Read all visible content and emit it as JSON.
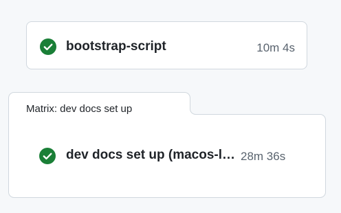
{
  "jobs": [
    {
      "name": "bootstrap-script",
      "duration": "10m 4s",
      "status": "success"
    }
  ],
  "matrix": {
    "title": "Matrix: dev docs set up",
    "jobs": [
      {
        "name": "dev docs set up (macos-latest)",
        "duration": "28m 36s",
        "status": "success"
      }
    ]
  },
  "colors": {
    "success": "#1a7f37",
    "border": "#d0d7de",
    "muted_text": "#59636e",
    "background": "#f6f8fa"
  },
  "icons": {
    "success": "check-circle-fill-icon"
  }
}
